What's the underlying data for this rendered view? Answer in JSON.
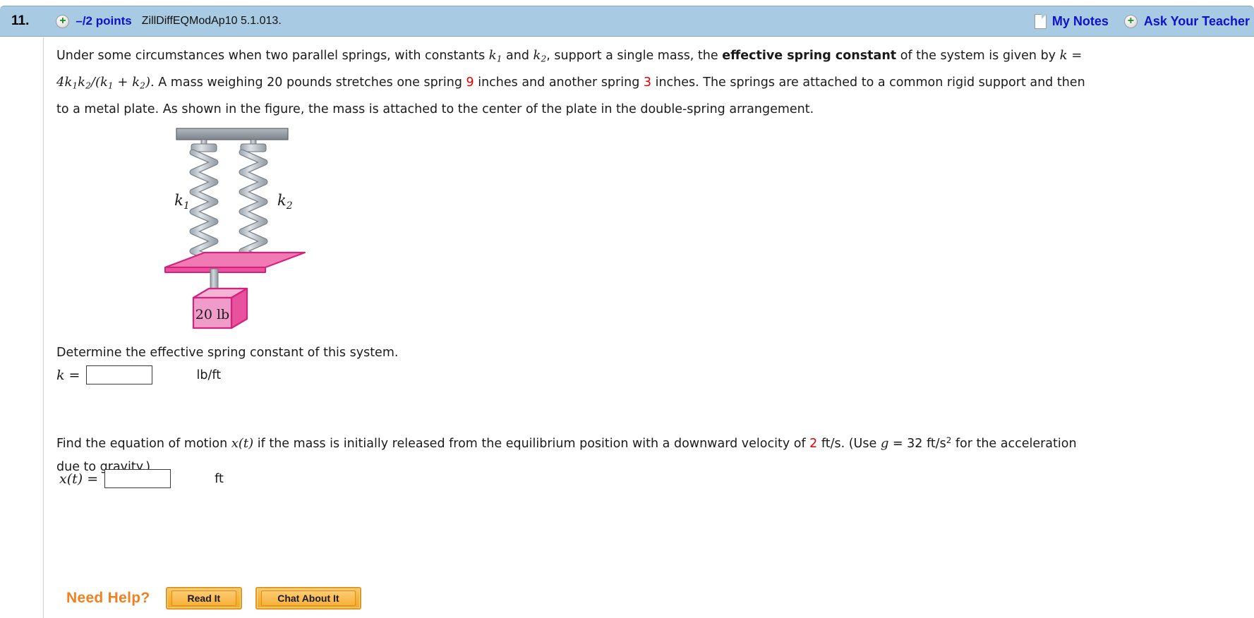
{
  "header": {
    "question_number": "11.",
    "plus_icon": "plus-circle-icon",
    "points": "–/2 points",
    "question_code": "ZillDiffEQModAp10 5.1.013.",
    "notes_icon": "note-page-icon",
    "my_notes_label": "My Notes",
    "ask_plus_icon": "plus-circle-icon",
    "ask_teacher_label": "Ask Your Teacher",
    "bar_color": "#a8cbe3",
    "link_color": "#1010cf"
  },
  "problem": {
    "part1_a": "Under some circumstances when two parallel springs, with constants ",
    "k1": "k",
    "k1_sub": "1",
    "part1_b": " and ",
    "k2": "k",
    "k2_sub": "2",
    "part1_c": ", support a single mass, the ",
    "bold_term": "effective spring constant",
    "part1_d": " of the system is given by  ",
    "formula": "k = 4k1k2/(k1 + k2).",
    "part1_e": "  A mass weighing 20 pounds stretches one spring ",
    "stretch1": "9",
    "part1_f": " inches and another spring ",
    "stretch2": "3",
    "part1_g": " inches. The springs are attached to a common rigid support and then to a metal plate. As shown in the figure, the mass is attached to the center of the plate in the double-spring arrangement.",
    "red_color": "#e00000"
  },
  "figure": {
    "name": "double-spring-diagram",
    "spring1_label": "k",
    "spring1_sub": "1",
    "spring2_label": "k",
    "spring2_sub": "2",
    "mass_label": "20 lb",
    "support_color": "#9aa0a8",
    "spring_color": "#c3cbd3",
    "plate_color": "#ef7ab4",
    "plate_edge_color": "#d6227d",
    "mass_color": "#f09ccb",
    "rod_color": "#a8b0b8"
  },
  "part_a": {
    "prompt": "Determine the effective spring constant of this system.",
    "label": "k =",
    "value": "",
    "unit": "lb/ft"
  },
  "part_b": {
    "prompt_a": "Find the equation of motion  ",
    "xt": "x(t)",
    "prompt_b": "  if the mass is initially released from the equilibrium position with a downward velocity of ",
    "velocity": "2",
    "prompt_c": " ft/s. (Use  ",
    "g_symbol": "g",
    "prompt_d": " = 32 ft/s",
    "g_exp": "2",
    "prompt_e": "  for the acceleration due to gravity.)",
    "label": "x(t) =",
    "value": "",
    "unit": "ft"
  },
  "need_help": {
    "label": "Need Help?",
    "read_it": "Read It",
    "chat_about_it": "Chat About It",
    "accent_color": "#f08020"
  }
}
